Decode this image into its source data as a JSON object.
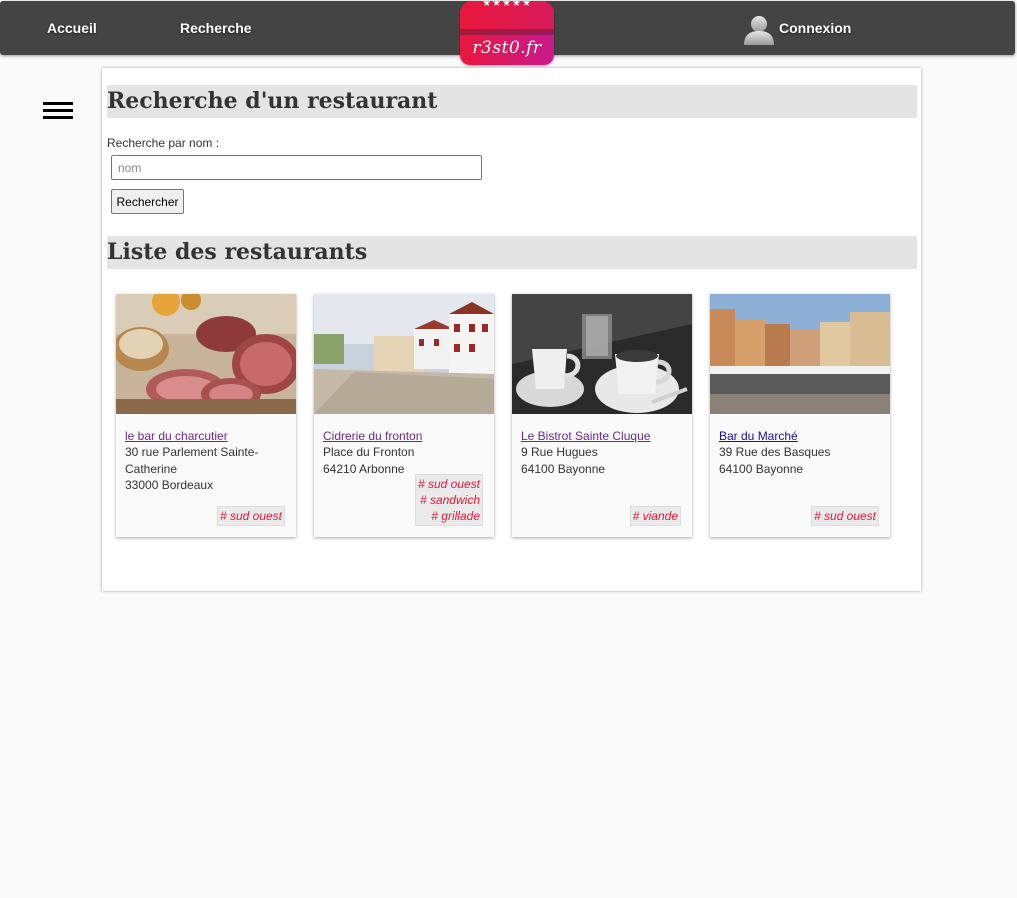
{
  "nav": {
    "accueil": "Accueil",
    "recherche": "Recherche",
    "connexion": "Connexion",
    "logo_text": "r3st0.fr",
    "logo_stars": "★★★★★"
  },
  "search": {
    "title": "Recherche d'un restaurant",
    "label": "Recherche par nom :",
    "placeholder": "nom",
    "button": "Rechercher"
  },
  "list": {
    "title": "Liste des restaurants",
    "restaurants": [
      {
        "name": "le bar du charcutier",
        "address_lines": [
          "30 rue Parlement Sainte-",
          "Catherine",
          "33000 Bordeaux"
        ],
        "tags": [
          "# sud ouest"
        ],
        "image": "charcuterie-photo"
      },
      {
        "name": "Cidrerie du fronton",
        "address_lines": [
          "Place du Fronton",
          "64210 Arbonne"
        ],
        "tags": [
          "# sud ouest",
          "# sandwich",
          "# grillade"
        ],
        "image": "fronton-photo"
      },
      {
        "name": "Le Bistrot Sainte Cluque",
        "address_lines": [
          "9 Rue Hugues",
          "64100 Bayonne"
        ],
        "tags": [
          "# viande"
        ],
        "image": "coffee-photo"
      },
      {
        "name": "Bar du Marché",
        "address_lines": [
          "39 Rue des Basques",
          "64100 Bayonne"
        ],
        "tags": [
          "# sud ouest"
        ],
        "image": "market-square-photo"
      }
    ]
  },
  "colors": {
    "nav_bg": "#444444",
    "logo_gradient_start": "#e8183c",
    "logo_gradient_end": "#c81a8e",
    "tag_color": "#e8183c",
    "visited_link": "#6b2a8c",
    "link": "#1a0dab"
  }
}
